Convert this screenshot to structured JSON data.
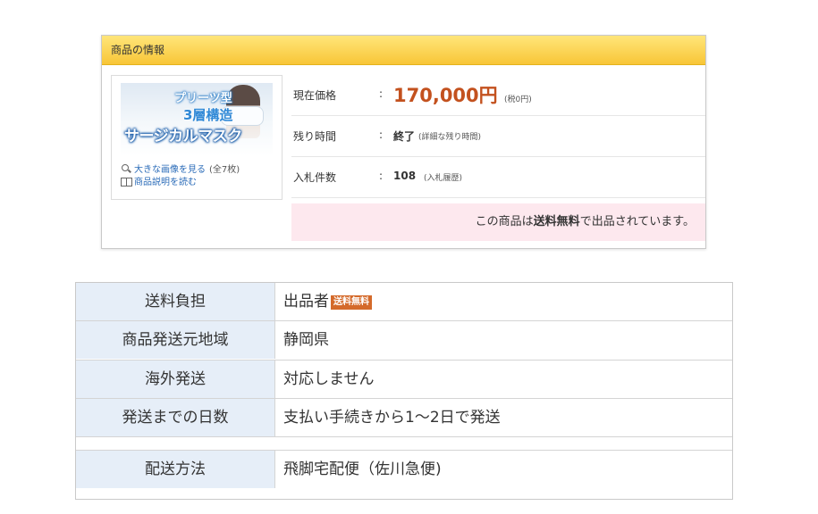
{
  "card": {
    "header_title": "商品の情報",
    "thumbnail": {
      "line1": "プリーツ型",
      "line2": "3層構造",
      "line3": "サージカルマスク"
    },
    "links": {
      "large_image": "大きな画像を見る",
      "large_image_count": "(全7枚)",
      "description": "商品説明を読む"
    },
    "rows": {
      "price_label": "現在価格",
      "price_value": "170,000円",
      "price_tax": "(税0円)",
      "time_label": "残り時間",
      "time_value": "終了",
      "time_link": "(詳細な残り時間)",
      "bids_label": "入札件数",
      "bids_value": "108",
      "bids_link": "(入札履歴)",
      "colon": ":"
    },
    "shipping_banner": {
      "prefix": "この商品は",
      "bold": "送料無料",
      "suffix": "で出品されています。"
    }
  },
  "table": {
    "rows": [
      {
        "label": "送料負担",
        "value": "出品者",
        "badge": "送料無料"
      },
      {
        "label": "商品発送元地域",
        "value": "静岡県"
      },
      {
        "label": "海外発送",
        "value": "対応しません"
      },
      {
        "label": "発送までの日数",
        "value": "支払い手続きから1～2日で発送"
      },
      {
        "label": "配送方法",
        "value": "飛脚宅配便（佐川急便)"
      }
    ]
  },
  "colors": {
    "header_gradient_top": "#ffe67a",
    "header_gradient_bottom": "#f8c637",
    "price": "#c3511e",
    "banner_bg": "#fde8ee",
    "table_label_bg": "#e6eef8",
    "badge_bg": "#d46a2b",
    "link": "#2a6bb8"
  }
}
